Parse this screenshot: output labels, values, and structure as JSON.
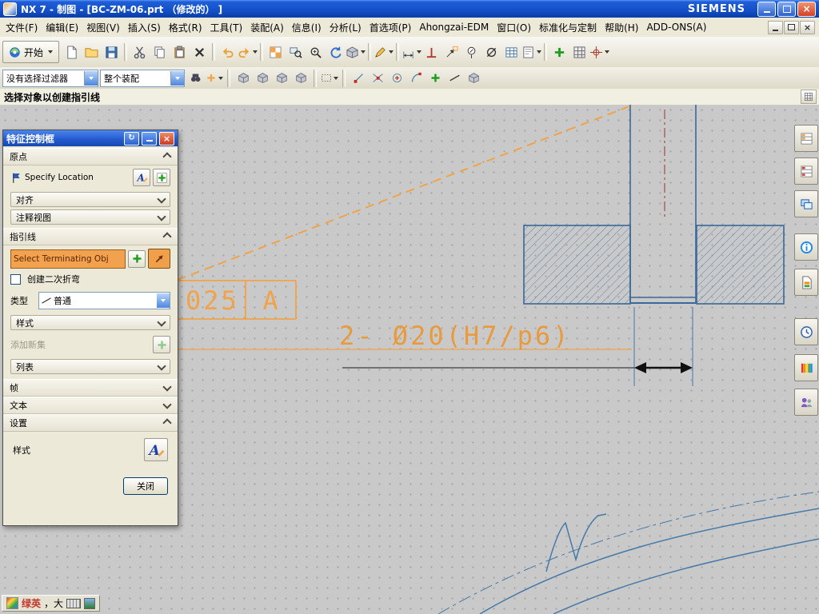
{
  "window": {
    "title": "NX 7 - 制图 - [BC-ZM-06.prt （修改的） ]",
    "brand": "SIEMENS"
  },
  "menu": {
    "items": [
      "文件(F)",
      "编辑(E)",
      "视图(V)",
      "插入(S)",
      "格式(R)",
      "工具(T)",
      "装配(A)",
      "信息(I)",
      "分析(L)",
      "首选项(P)",
      "Ahongzai-EDM",
      "窗口(O)",
      "标准化与定制",
      "帮助(H)",
      "ADD-ONS(A)"
    ]
  },
  "toolbar": {
    "start_label": "开始",
    "selection_filter": "没有选择过滤器",
    "selection_scope": "整个装配"
  },
  "prompt": {
    "text": "选择对象以创建指引线"
  },
  "dialog": {
    "title": "特征控制框",
    "groups": {
      "origin": "原点",
      "leader": "指引线",
      "frame": "帧",
      "text": "文本",
      "settings": "设置"
    },
    "fields": {
      "specify_location": "Specify Location",
      "align": "对齐",
      "annotation_view": "注释视图",
      "select_terminating": "Select Terminating Obj",
      "create_double_bend": "创建二次折弯",
      "type_label": "类型",
      "type_value": "普通",
      "style": "样式",
      "add_new_set": "添加新集",
      "list": "列表",
      "settings_style": "样式"
    },
    "close_button": "关闭"
  },
  "canvas": {
    "fcf_value": "025",
    "fcf_datum": "A",
    "dimension_text": "2- Ø20(H7/p6)"
  },
  "ime": {
    "left": "绿英",
    "right": "，大"
  },
  "colors": {
    "accent_orange": "#F0A348",
    "geometry_blue": "#4679A8",
    "centerline_maroon": "#993333",
    "dimension_black": "#1A1A1A",
    "canvas_gray": "#C9C9C9"
  },
  "icons": {
    "toolbar_main": [
      "start",
      "new-file",
      "open",
      "save",
      "cut",
      "copy",
      "paste",
      "delete",
      "undo",
      "redo",
      "display-checker",
      "fit-view",
      "zoom",
      "refresh",
      "orient-cube",
      "sketch",
      "linear-dimension",
      "perpendicular",
      "leader",
      "balloon-note",
      "diameter-dimension",
      "table",
      "note",
      "point",
      "crosshair",
      "grid"
    ],
    "toolbar_selection": [
      "find",
      "add-selection",
      "shaded-cube",
      "rectangle-select",
      "snap-endpoint",
      "snap-intersection",
      "snap-center",
      "snap-quadrant",
      "snap-point",
      "work-cube"
    ],
    "sidebar": [
      "assembly-navigator",
      "constraint-navigator",
      "part-navigator",
      "internet",
      "reuse-library",
      "history",
      "materials",
      "roles"
    ],
    "dialog": [
      "reset",
      "minimize",
      "close",
      "position-flag",
      "style-editor-a",
      "point-constructor",
      "add-leader",
      "leader-select",
      "linetype"
    ]
  }
}
